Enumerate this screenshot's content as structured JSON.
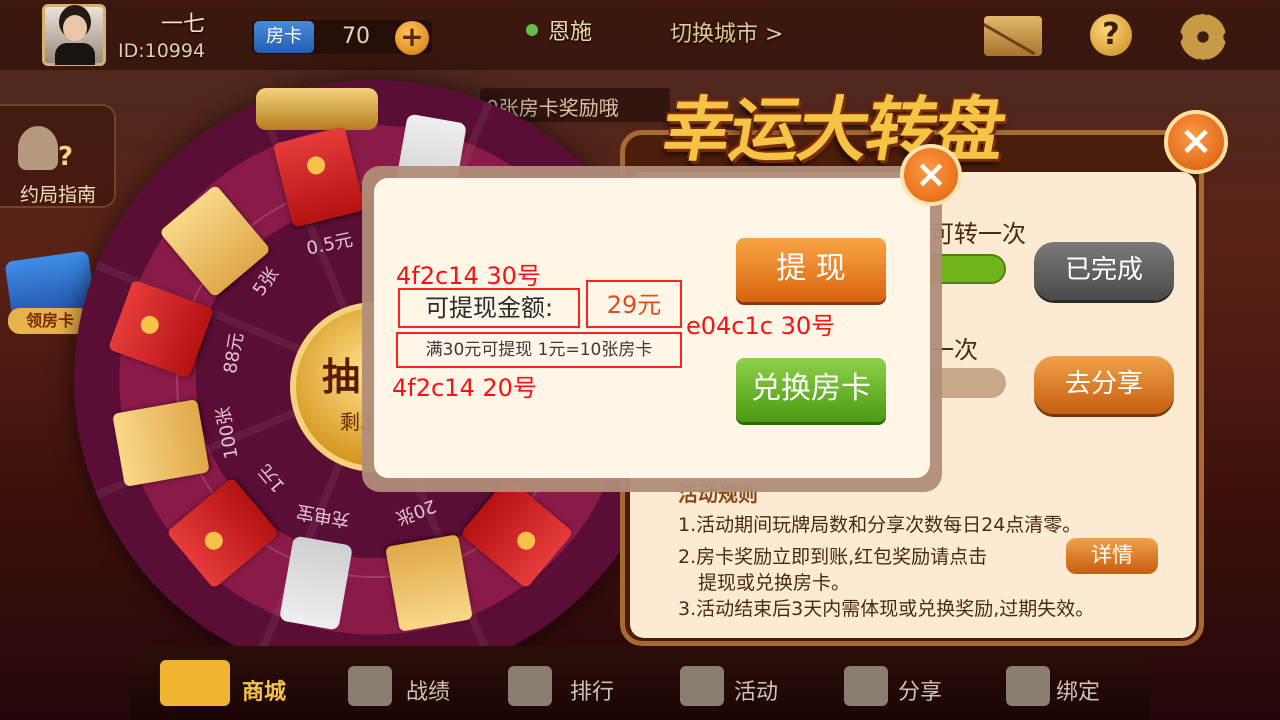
{
  "header": {
    "username": "一七",
    "user_id": "ID:10994",
    "card_label": "房卡",
    "card_count": "70",
    "plus": "+",
    "city": "恩施",
    "switch_city": "切换城市 >",
    "help": "?"
  },
  "ticker": "0张房卡奖励哦",
  "sidebar": {
    "guide_label": "约局指南",
    "bonus_label": "领房卡"
  },
  "wheel": {
    "hub_label": "抽",
    "hub_sub": "剩3",
    "labels": [
      "0.5元",
      "5张",
      "88元",
      "100张",
      "1元",
      "充电宝",
      "20张"
    ]
  },
  "panel": {
    "title": "幸运大转盘",
    "task1": "可转一次",
    "task2": "一次",
    "done_label": "已完成",
    "share_label": "去分享",
    "rules_title": "活动规则",
    "rules": [
      "1.活动期间玩牌局数和分享次数每日24点清零。",
      "2.房卡奖励立即到账,红包奖励请点击",
      "提现或兑换房卡。",
      "3.活动结束后3天内需体现或兑换奖励,过期失效。"
    ],
    "detail_label": "详情",
    "close": "×"
  },
  "dialog": {
    "amount_label": "可提现金额:",
    "amount_value": "29元",
    "condition": "满30元可提现 1元=10张房卡",
    "withdraw_label": "提 现",
    "exchange_label": "兑换房卡",
    "close": "×"
  },
  "annotations": {
    "label_style": "4f2c14 30号",
    "value_style": "e04c1c 30号",
    "cond_style": "4f2c14 20号"
  },
  "nav": {
    "shop": "商城",
    "record": "战绩",
    "rank": "排行",
    "activity": "活动",
    "share": "分享",
    "bind": "绑定"
  },
  "colors": {
    "label_text": "#4f2c14",
    "value_text": "#e04c1c",
    "annotation": "#ff1010"
  }
}
